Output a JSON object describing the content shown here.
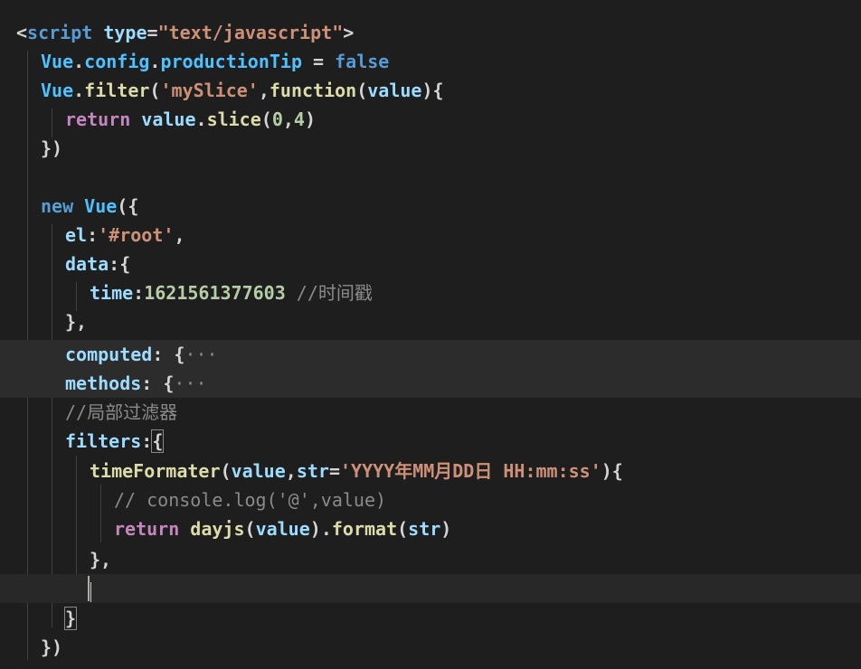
{
  "editor": {
    "lines": [
      {
        "t1": "<",
        "t2": "script",
        "t3": " type",
        "t4": "=",
        "t5": "\"text/javascript\"",
        "t6": ">"
      },
      {
        "t1": "Vue",
        "t2": ".",
        "t3": "config",
        "t4": ".",
        "t5": "productionTip",
        "t6": " = ",
        "t7": "false"
      },
      {
        "t1": "Vue",
        "t2": ".",
        "t3": "filter",
        "t4": "(",
        "t5": "'mySlice'",
        "t6": ",",
        "t7": "function",
        "t8": "(",
        "t9": "value",
        "t10": "){"
      },
      {
        "t1": "return",
        "t2": " ",
        "t3": "value",
        "t4": ".",
        "t5": "slice",
        "t6": "(",
        "t7": "0",
        "t8": ",",
        "t9": "4",
        "t10": ")"
      },
      {
        "t1": "})"
      },
      {},
      {
        "t1": "new",
        "t2": " ",
        "t3": "Vue",
        "t4": "({"
      },
      {
        "t1": "el",
        "t2": ":",
        "t3": "'#root'",
        "t4": ","
      },
      {
        "t1": "data",
        "t2": ":{"
      },
      {
        "t1": "time",
        "t2": ":",
        "t3": "1621561377603",
        "t4": " //时间戳"
      },
      {
        "t1": "},"
      },
      {
        "t1": "computed",
        "t2": ": {",
        "t3": "···"
      },
      {
        "t1": "methods",
        "t2": ": {",
        "t3": "···"
      },
      {
        "t1": "//局部过滤器"
      },
      {
        "t1": "filters",
        "t2": ":",
        "t3": "{"
      },
      {
        "t1": "timeFormater",
        "t2": "(",
        "t3": "value",
        "t4": ",",
        "t5": "str",
        "t6": "=",
        "t7": "'YYYY年MM月DD日 HH:mm:ss'",
        "t8": "){"
      },
      {
        "t1": "// console.log('@',value)"
      },
      {
        "t1": "return",
        "t2": " ",
        "t3": "dayjs",
        "t4": "(",
        "t5": "value",
        "t6": ").",
        "t7": "format",
        "t8": "(",
        "t9": "str",
        "t10": ")"
      },
      {
        "t1": "},"
      },
      {},
      {
        "t1": "}"
      },
      {
        "t1": "})"
      }
    ]
  },
  "colors": {
    "background": "#1e1e1e",
    "keyword": "#569cd6",
    "string": "#ce9178",
    "function": "#dcdcaa",
    "property": "#9cdcfe",
    "control": "#c586c0",
    "number": "#b5cea8",
    "comment": "#8a8a8a"
  }
}
